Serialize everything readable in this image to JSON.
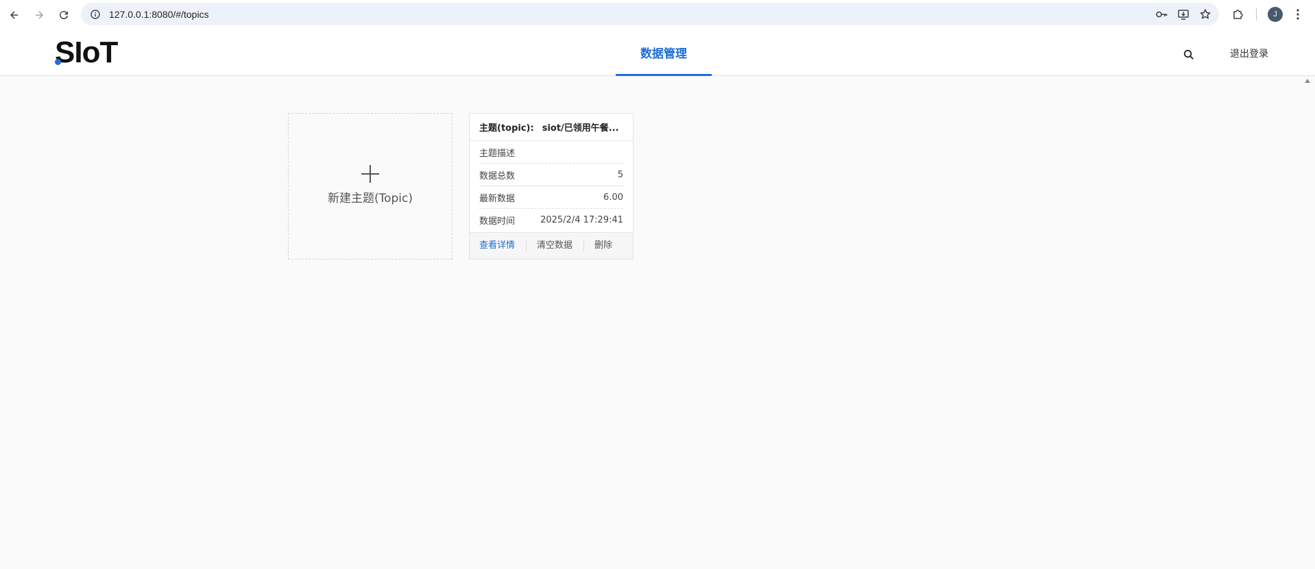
{
  "browser": {
    "url": "127.0.0.1:8080/#/topics",
    "avatar_initial": "J",
    "icons": [
      "back-icon",
      "forward-icon",
      "reload-icon",
      "site-info-icon",
      "password-key-icon",
      "install-app-icon",
      "bookmark-star-icon",
      "extensions-icon",
      "more-menu-icon"
    ]
  },
  "header": {
    "logo": "SIoT",
    "tab_label": "数据管理",
    "logout_label": "退出登录",
    "accent_color": "#1e6dd8"
  },
  "new_topic": {
    "label": "新建主题(Topic)"
  },
  "topic_card": {
    "title_label": "主题(topic):",
    "title_value": "siot/已领用午餐...",
    "rows": [
      {
        "label": "主题描述",
        "value": ""
      },
      {
        "label": "数据总数",
        "value": "5"
      },
      {
        "label": "最新数据",
        "value": "6.00"
      },
      {
        "label": "数据时间",
        "value": "2025/2/4 17:29:41"
      }
    ],
    "actions": {
      "view": "查看详情",
      "clear": "清空数据",
      "delete": "删除"
    }
  }
}
